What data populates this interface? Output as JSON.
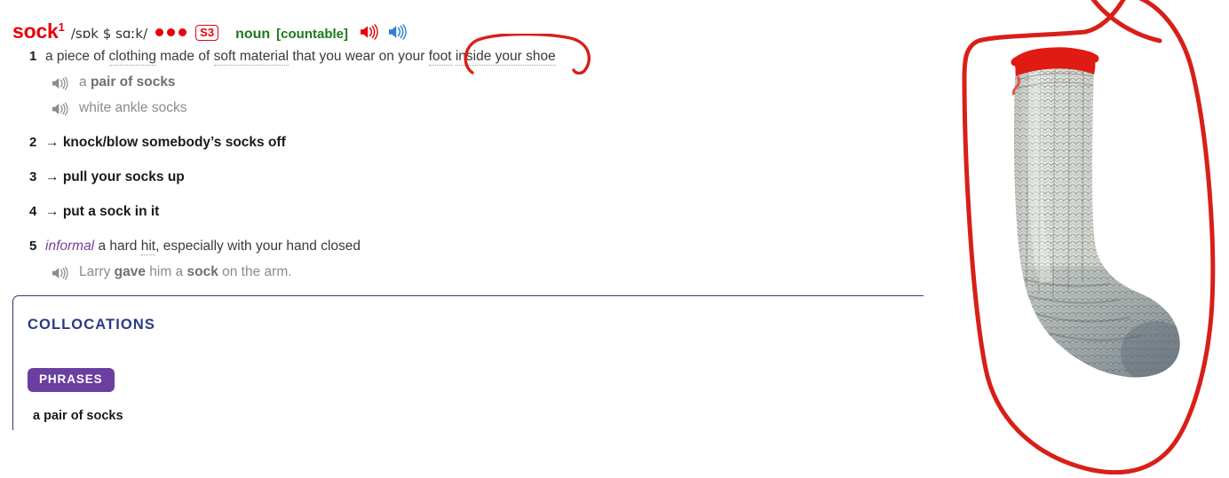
{
  "entry": {
    "headword": "sock",
    "homonym_number": "1",
    "pronunciation": "/sɒk $ sɑːk/",
    "frequency_dots": 3,
    "frequency_badge": "S3",
    "part_of_speech": "noun",
    "grammar_label": "[countable]",
    "pronounce_british_icon": "speaker-icon",
    "pronounce_american_icon": "speaker-icon",
    "colors": {
      "headword": "#e8000d",
      "part_of_speech": "#1b7a1b",
      "register": "#7a3d9e",
      "collocations_title": "#2a3a87",
      "phrases_badge": "#6a3fa0",
      "annotation": "#d81f18"
    },
    "senses": [
      {
        "number": "1",
        "definition_parts": [
          {
            "text": "a piece of ",
            "style": "plain"
          },
          {
            "text": "clothing",
            "style": "dotted"
          },
          {
            "text": " made of ",
            "style": "plain"
          },
          {
            "text": "soft material",
            "style": "dotted"
          },
          {
            "text": " that you wear on your ",
            "style": "plain"
          },
          {
            "text": "foot",
            "style": "dotted"
          },
          {
            "text": " ",
            "style": "plain"
          },
          {
            "text": "inside your shoe",
            "style": "dotted"
          }
        ],
        "examples": [
          [
            {
              "text": "a ",
              "style": "plain"
            },
            {
              "text": "pair of socks",
              "style": "bold"
            }
          ],
          [
            {
              "text": "white ankle socks",
              "style": "plain"
            }
          ]
        ]
      },
      {
        "number": "2",
        "cross_reference": "knock/blow somebody’s socks off",
        "arrow": "→"
      },
      {
        "number": "3",
        "cross_reference": "pull your socks up",
        "arrow": "→"
      },
      {
        "number": "4",
        "cross_reference": "put a sock in it",
        "arrow": "→"
      },
      {
        "number": "5",
        "register": "informal",
        "definition_parts": [
          {
            "text": "a hard ",
            "style": "plain"
          },
          {
            "text": "hit",
            "style": "dotted"
          },
          {
            "text": ", especially with your hand closed",
            "style": "plain"
          }
        ],
        "examples": [
          [
            {
              "text": "Larry ",
              "style": "plain"
            },
            {
              "text": "gave",
              "style": "bold"
            },
            {
              "text": " him a ",
              "style": "plain"
            },
            {
              "text": "sock",
              "style": "bold"
            },
            {
              "text": " on the arm.",
              "style": "plain"
            }
          ]
        ]
      }
    ]
  },
  "collocations": {
    "title": "COLLOCATIONS",
    "badge": "PHRASES",
    "items": [
      "a pair of socks"
    ]
  },
  "illustration": {
    "alt": "knitted grey sock with red cuff",
    "annotation_name": "hand-drawn-red-outline"
  }
}
